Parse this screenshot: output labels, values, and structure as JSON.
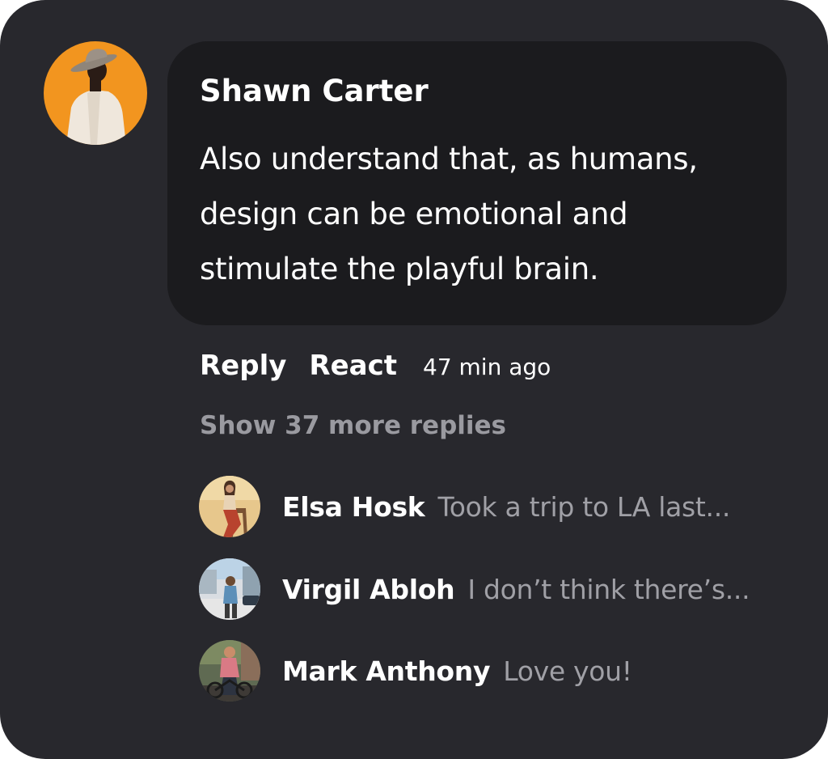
{
  "comment": {
    "author": "Shawn Carter",
    "avatar": "person-wearing-hat-photo",
    "text": "Also understand that, as humans, design can be emotional and stimulate the playful brain.",
    "actions": {
      "reply_label": "Reply",
      "react_label": "React"
    },
    "time_ago": "47 min ago",
    "show_more_label": "Show 37 more replies"
  },
  "replies": [
    {
      "name": "Elsa Hosk",
      "preview": "Took a trip to LA last...",
      "avatar": "woman-on-chair-photo"
    },
    {
      "name": "Virgil Abloh",
      "preview": "I don’t think there’s...",
      "avatar": "man-on-street-photo"
    },
    {
      "name": "Mark Anthony",
      "preview": "Love you!",
      "avatar": "man-with-bicycle-photo"
    }
  ],
  "colors": {
    "card_background": "#28282d",
    "bubble_background": "#1b1b1e",
    "primary_text": "#ffffff",
    "secondary_text": "#9a9aa0",
    "main_avatar_background": "#f2951f"
  }
}
